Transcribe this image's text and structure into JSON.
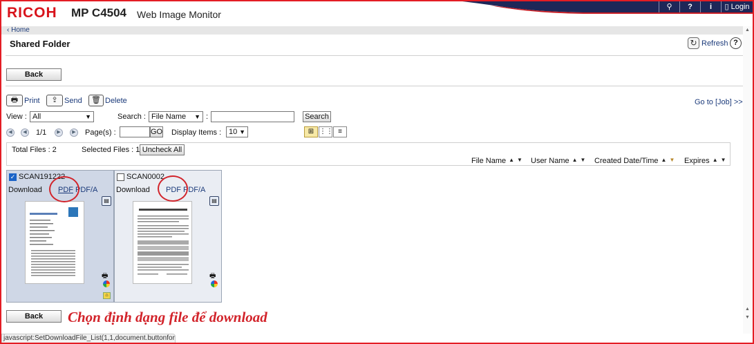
{
  "header": {
    "brand": "RICOH",
    "model": "MP C4504",
    "product": "Web Image Monitor",
    "tools": {
      "search_glyph": "⚲",
      "help_glyph": "?",
      "info_glyph": "i",
      "login_label": "Login"
    },
    "colors": {
      "brand_red": "#d8131b",
      "bar_navy": "#1e2758"
    }
  },
  "breadcrumb": {
    "home_label": "Home"
  },
  "page": {
    "title": "Shared Folder",
    "refresh_label": "Refresh",
    "help_glyph": "?"
  },
  "buttons": {
    "back_label": "Back",
    "uncheck_all_label": "Uncheck All",
    "search_label": "Search",
    "go_label": "GO"
  },
  "toolbar": {
    "print_label": "Print",
    "send_label": "Send",
    "delete_label": "Delete",
    "goto_label": "Go to [Job] >>"
  },
  "filters": {
    "view_label": "View :",
    "view_value": "All",
    "search_label": "Search :",
    "search_field_value": "File Name",
    "search_text": ""
  },
  "pager": {
    "page_indicator": "1/1",
    "pages_label": "Page(s) :",
    "pages_value": "",
    "display_items_label": "Display Items :",
    "display_items_value": "10"
  },
  "summary": {
    "total_files": "Total Files : 2",
    "selected_files": "Selected Files : 1"
  },
  "columns": [
    "File Name",
    "User Name",
    "Created Date/Time",
    "Expires"
  ],
  "files": [
    {
      "name": "SCAN191222",
      "checked": true,
      "download_label": "Download",
      "pdf_label": "PDF",
      "pdfa_label": "PDF/A"
    },
    {
      "name": "SCAN0002",
      "checked": false,
      "download_label": "Download",
      "pdf_label": "PDF",
      "pdfa_label": "PDF/A"
    }
  ],
  "annotation": "Chọn định dạng file để download",
  "status_bar": "javascript:SetDownloadFile_List(1,1,document.buttonform)"
}
